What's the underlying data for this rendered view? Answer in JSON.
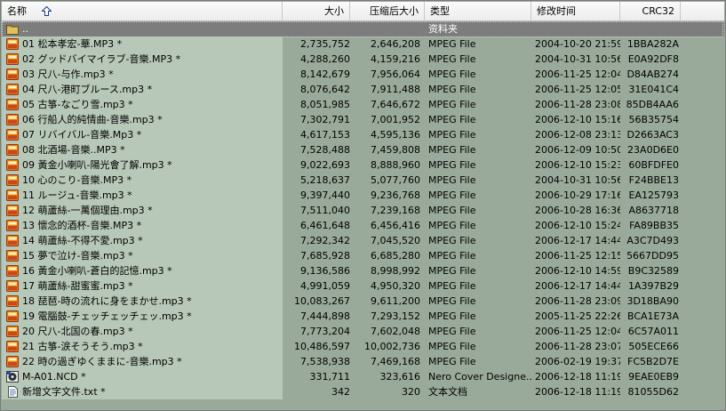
{
  "columns": {
    "name": "名称",
    "size": "大小",
    "packed": "压缩后大小",
    "type": "类型",
    "modified": "修改时间",
    "crc": "CRC32"
  },
  "parent_row": {
    "name": "..",
    "type": "资料夹"
  },
  "files": [
    {
      "name": "01 松本孝宏-華.MP3 *",
      "size": "2,735,752",
      "packed": "2,646,208",
      "type": "MPEG File",
      "modified": "2004-10-20 21:59",
      "crc": "1BBA282A",
      "icon": "audio-file-icon"
    },
    {
      "name": "02 グッドバイマイラブ-音樂.MP3 *",
      "size": "4,288,260",
      "packed": "4,159,216",
      "type": "MPEG File",
      "modified": "2004-10-31 10:56",
      "crc": "E0A92DF8",
      "icon": "audio-file-icon"
    },
    {
      "name": "03 尺八-与作.mp3 *",
      "size": "8,142,679",
      "packed": "7,956,064",
      "type": "MPEG File",
      "modified": "2006-11-25 12:04",
      "crc": "D84AB274",
      "icon": "audio-file-icon"
    },
    {
      "name": "04 尺八-港町ブルース.mp3 *",
      "size": "8,076,642",
      "packed": "7,911,488",
      "type": "MPEG File",
      "modified": "2006-11-25 12:05",
      "crc": "31E041C4",
      "icon": "audio-file-icon"
    },
    {
      "name": "05 古箏-なごり雪.mp3 *",
      "size": "8,051,985",
      "packed": "7,646,672",
      "type": "MPEG File",
      "modified": "2006-11-28 23:08",
      "crc": "85DB4AA6",
      "icon": "audio-file-icon"
    },
    {
      "name": "06 行船人的純情曲-音樂.mp3 *",
      "size": "7,302,791",
      "packed": "7,001,952",
      "type": "MPEG File",
      "modified": "2006-12-10 15:16",
      "crc": "56B35754",
      "icon": "audio-file-icon"
    },
    {
      "name": "07 リバイバル-音樂.Mp3 *",
      "size": "4,617,153",
      "packed": "4,595,136",
      "type": "MPEG File",
      "modified": "2006-12-08 23:13",
      "crc": "D2663AC3",
      "icon": "audio-file-icon"
    },
    {
      "name": "08 北酒場-音樂..MP3 *",
      "size": "7,528,488",
      "packed": "7,459,808",
      "type": "MPEG File",
      "modified": "2006-12-09 10:50",
      "crc": "23A0D6E0",
      "icon": "audio-file-icon"
    },
    {
      "name": "09 黃金小喇叭-陽光會了解.mp3 *",
      "size": "9,022,693",
      "packed": "8,888,960",
      "type": "MPEG File",
      "modified": "2006-12-10 15:23",
      "crc": "60BFDFE0",
      "icon": "audio-file-icon"
    },
    {
      "name": "10 心のこり-音樂.MP3 *",
      "size": "5,218,637",
      "packed": "5,077,760",
      "type": "MPEG File",
      "modified": "2004-10-31 10:56",
      "crc": "F24BBE13",
      "icon": "audio-file-icon"
    },
    {
      "name": "11 ルージュ-音樂.mp3 *",
      "size": "9,397,440",
      "packed": "9,236,768",
      "type": "MPEG File",
      "modified": "2006-10-29 17:16",
      "crc": "EA125793",
      "icon": "audio-file-icon"
    },
    {
      "name": "12 萌蘆絲-一萬個理由.mp3 *",
      "size": "7,511,040",
      "packed": "7,239,168",
      "type": "MPEG File",
      "modified": "2006-10-28 16:36",
      "crc": "A8637718",
      "icon": "audio-file-icon"
    },
    {
      "name": "13 懷念的酒杯-音樂.MP3 *",
      "size": "6,461,648",
      "packed": "6,456,416",
      "type": "MPEG File",
      "modified": "2006-12-10 15:24",
      "crc": "FA89BB35",
      "icon": "audio-file-icon"
    },
    {
      "name": "14 萌蘆絲-不得不愛.mp3 *",
      "size": "7,292,342",
      "packed": "7,045,520",
      "type": "MPEG File",
      "modified": "2006-12-17 14:44",
      "crc": "A3C7D493",
      "icon": "audio-file-icon"
    },
    {
      "name": "15 夢で泣け-音樂.mp3 *",
      "size": "7,685,928",
      "packed": "6,685,280",
      "type": "MPEG File",
      "modified": "2006-11-25 12:15",
      "crc": "5667DD95",
      "icon": "audio-file-icon"
    },
    {
      "name": "16 黃金小喇叭-蒼白的記憶.mp3 *",
      "size": "9,136,586",
      "packed": "8,998,992",
      "type": "MPEG File",
      "modified": "2006-12-10 14:59",
      "crc": "B9C32589",
      "icon": "audio-file-icon"
    },
    {
      "name": "17 萌蘆絲-甜蜜蜜.mp3 *",
      "size": "4,991,059",
      "packed": "4,950,320",
      "type": "MPEG File",
      "modified": "2006-12-17 14:44",
      "crc": "1A397B29",
      "icon": "audio-file-icon"
    },
    {
      "name": "18 琵琶-時の流れに身をまかせ.mp3 *",
      "size": "10,083,267",
      "packed": "9,611,200",
      "type": "MPEG File",
      "modified": "2006-11-28 23:09",
      "crc": "3D18BA90",
      "icon": "audio-file-icon"
    },
    {
      "name": "19 電腦鼓-チェッチェッチェッ.mp3 *",
      "size": "7,444,898",
      "packed": "7,293,152",
      "type": "MPEG File",
      "modified": "2005-11-25 22:26",
      "crc": "BCA1E73A",
      "icon": "audio-file-icon"
    },
    {
      "name": "20 尺八-北国の春.mp3 *",
      "size": "7,773,204",
      "packed": "7,602,048",
      "type": "MPEG File",
      "modified": "2006-11-25 12:04",
      "crc": "6C57A011",
      "icon": "audio-file-icon"
    },
    {
      "name": "21 古箏-涙そうそう.mp3 *",
      "size": "10,486,597",
      "packed": "10,002,736",
      "type": "MPEG File",
      "modified": "2006-11-28 23:07",
      "crc": "505ECE66",
      "icon": "audio-file-icon"
    },
    {
      "name": "22 時の過ぎゆくままに-音樂.mp3 *",
      "size": "7,538,938",
      "packed": "7,469,168",
      "type": "MPEG File",
      "modified": "2006-02-19 19:37",
      "crc": "FC5B2D7E",
      "icon": "audio-file-icon"
    },
    {
      "name": "M-A01.NCD *",
      "size": "331,711",
      "packed": "323,616",
      "type": "Nero Cover Designe...",
      "modified": "2006-12-18 11:19",
      "crc": "9EAE0EB9",
      "icon": "nero-cover-icon"
    },
    {
      "name": "新增文字文件.txt *",
      "size": "342",
      "packed": "320",
      "type": "文本文档",
      "modified": "2006-12-18 11:19",
      "crc": "81055D62",
      "icon": "text-file-icon"
    }
  ],
  "colors": {
    "list_background": "#9aaa9a",
    "name_column_background": "#b8c8b8",
    "selected_row": "#7d7d7d",
    "audio_icon": "#e8782a"
  }
}
